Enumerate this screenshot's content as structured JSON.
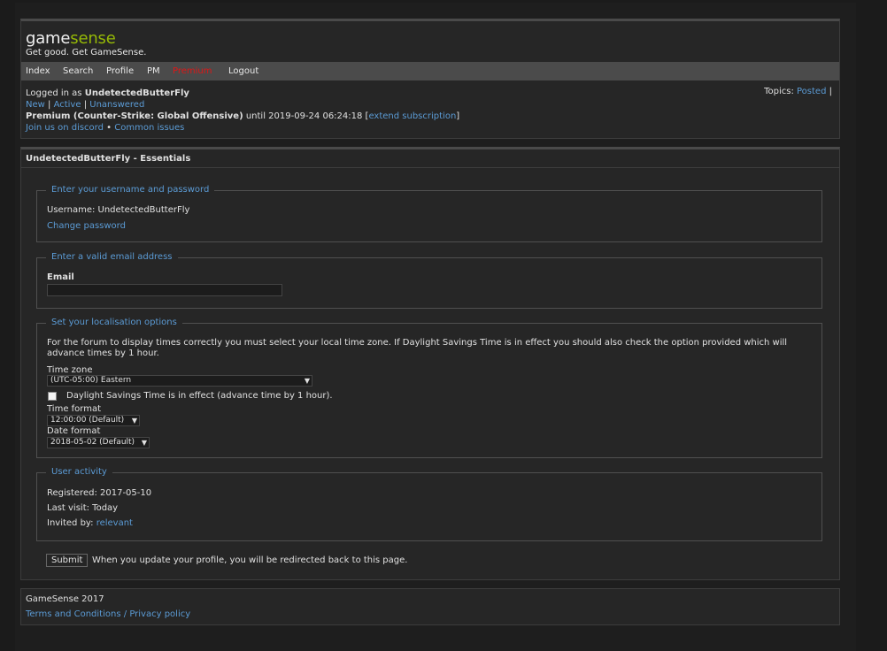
{
  "header": {
    "logo_prefix": "game",
    "logo_suffix": "sense",
    "tagline": "Get good. Get GameSense."
  },
  "nav": {
    "index": "Index",
    "search": "Search",
    "profile": "Profile",
    "pm": "PM",
    "premium": "Premium",
    "logout": "Logout"
  },
  "status": {
    "logged_in_prefix": "Logged in as",
    "username": "UndetectedButterFly",
    "new": "New",
    "active": "Active",
    "unanswered": "Unanswered",
    "sep": "|",
    "premium_label": "Premium (Counter-Strike: Global Offensive)",
    "until_text": "until 2019-09-24 06:24:18 [",
    "extend": "extend subscription",
    "close_bracket": "]",
    "discord": "Join us on discord",
    "bullet": "•",
    "common_issues": "Common issues",
    "topics_label": "Topics:",
    "posted": "Posted",
    "topics_sep": "|"
  },
  "main": {
    "title": "UndetectedButterFly - Essentials",
    "username_section": {
      "legend": "Enter your username and password",
      "username_text": "Username: UndetectedButterFly",
      "change_password": "Change password"
    },
    "email_section": {
      "legend": "Enter a valid email address",
      "email_label": "Email",
      "email_value": ""
    },
    "locale_section": {
      "legend": "Set your localisation options",
      "description_line1": "For the forum to display times correctly you must select your local time zone. If Daylight Savings Time is in effect you should also check the option provided which will",
      "description_line2": "advance times by 1 hour.",
      "timezone_label": "Time zone",
      "timezone_value": "(UTC-05:00) Eastern",
      "dst_label": "Daylight Savings Time is in effect (advance time by 1 hour).",
      "dst_checked": false,
      "time_format_label": "Time format",
      "time_format_value": "12:00:00 (Default)",
      "date_format_label": "Date format",
      "date_format_value": "2018-05-02 (Default)"
    },
    "activity_section": {
      "legend": "User activity",
      "registered": "Registered: 2017-05-10",
      "last_visit": "Last visit: Today",
      "invited_by_label": "Invited by:",
      "invited_by_user": "relevant"
    },
    "submit_label": "Submit",
    "submit_note": "When you update your profile, you will be redirected back to this page."
  },
  "footer": {
    "copyright": "GameSense 2017",
    "terms": "Terms and Conditions",
    "slash": "/",
    "privacy": "Privacy policy"
  },
  "colors": {
    "accent_logo": "#95b806",
    "link": "#5b9bd5",
    "premium_nav": "#e01616",
    "background": "#1b1b1b",
    "panel": "#262626",
    "navbar": "#4b4b4b"
  }
}
